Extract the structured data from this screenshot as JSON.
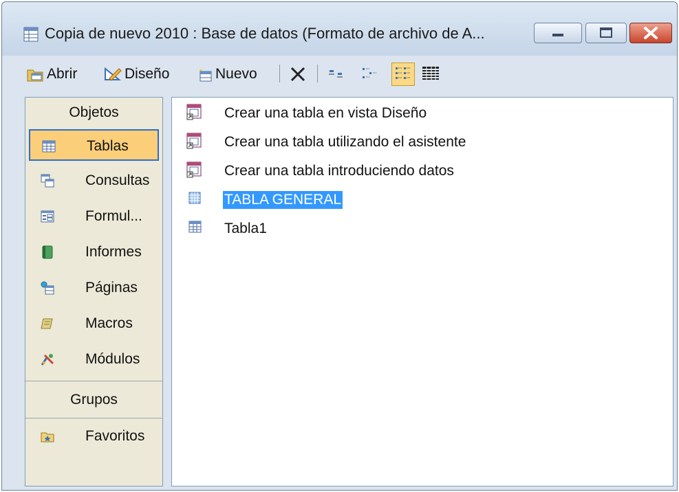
{
  "window": {
    "title": "Copia de nuevo 2010 : Base de datos (Formato de archivo de A...",
    "controls": [
      "minimize",
      "maximize",
      "close"
    ]
  },
  "toolbar": {
    "open_label": "Abrir",
    "design_label": "Diseño",
    "new_label": "Nuevo",
    "delete_icon": "delete-x-icon",
    "view_buttons": [
      "large-icons",
      "small-icons",
      "list",
      "details"
    ],
    "active_view": "list"
  },
  "sidebar": {
    "objects_header": "Objetos",
    "items": [
      {
        "label": "Tablas",
        "icon": "table-icon",
        "selected": true
      },
      {
        "label": "Consultas",
        "icon": "query-icon"
      },
      {
        "label": "Formul...",
        "icon": "form-icon"
      },
      {
        "label": "Informes",
        "icon": "report-icon"
      },
      {
        "label": "Páginas",
        "icon": "page-icon"
      },
      {
        "label": "Macros",
        "icon": "macro-icon"
      },
      {
        "label": "Módulos",
        "icon": "module-icon"
      }
    ],
    "groups_header": "Grupos",
    "groups": [
      {
        "label": "Favoritos",
        "icon": "favorites-folder-icon"
      }
    ]
  },
  "list": {
    "items": [
      {
        "label": "Crear una tabla en vista Diseño",
        "icon": "shortcut-icon"
      },
      {
        "label": "Crear una tabla utilizando el asistente",
        "icon": "shortcut-icon"
      },
      {
        "label": "Crear una tabla introduciendo datos",
        "icon": "shortcut-icon"
      },
      {
        "label": "TABLA GENERAL",
        "icon": "linked-table-icon",
        "selected": true
      },
      {
        "label": "Tabla1",
        "icon": "table-icon"
      }
    ]
  },
  "colors": {
    "selection_blue": "#3399ff",
    "nav_selected_bg": "#fbce7a",
    "nav_selected_border": "#2f6dc7",
    "panel_bg": "#ece9d8",
    "window_bg": "#dbe4ef",
    "close_red": "#c8452c"
  }
}
